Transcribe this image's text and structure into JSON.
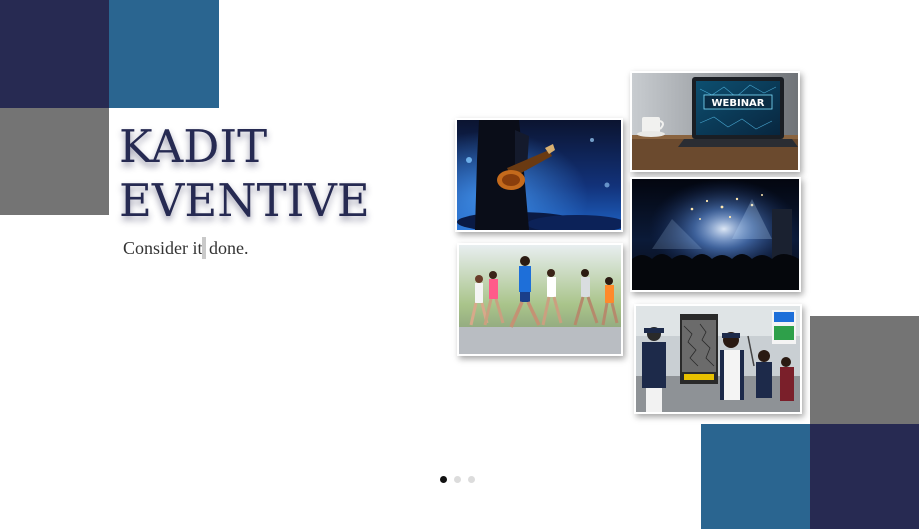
{
  "hero": {
    "title_line_1": "KADIT",
    "title_line_2": "EVENTIVE",
    "tagline_before_caret": "Consider it",
    "tagline_after_caret": " done."
  },
  "photos": {
    "webinar_screen_text": "WEBINAR"
  },
  "carousel": {
    "slide_count": 3,
    "active_index": 0
  },
  "colors": {
    "navy": "#272a52",
    "steel_blue": "#2a6590",
    "gray": "#747474",
    "title_text": "#262a52"
  }
}
